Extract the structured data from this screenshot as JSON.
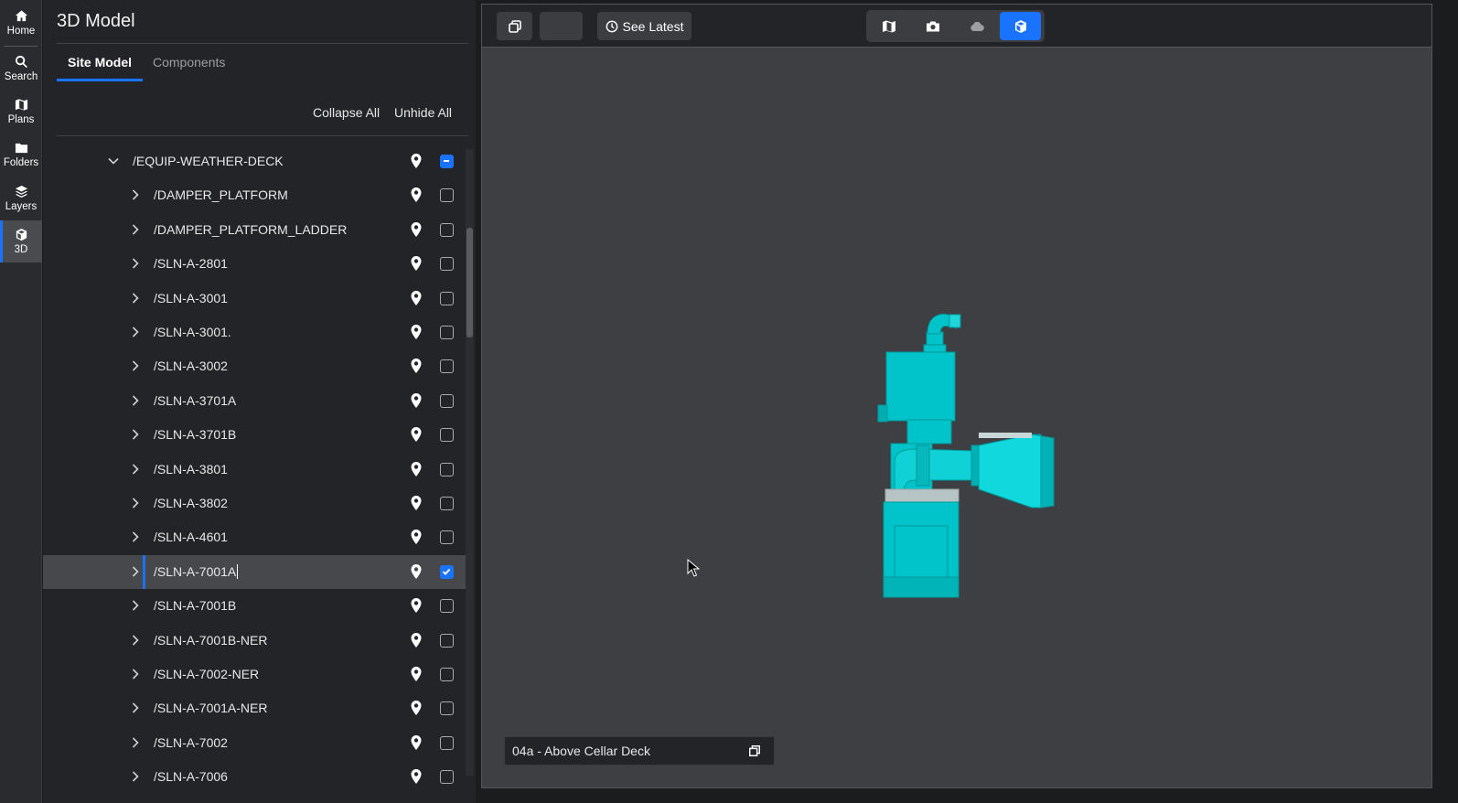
{
  "nav": {
    "items": [
      {
        "label": "Home",
        "icon": "home-icon"
      },
      {
        "label": "Search",
        "icon": "search-icon"
      },
      {
        "label": "Plans",
        "icon": "map-icon"
      },
      {
        "label": "Folders",
        "icon": "folder-icon"
      },
      {
        "label": "Layers",
        "icon": "layers-icon"
      },
      {
        "label": "3D",
        "icon": "cube-icon",
        "active": true
      }
    ]
  },
  "panel": {
    "title": "3D Model",
    "tabs": [
      {
        "label": "Site Model",
        "active": true
      },
      {
        "label": "Components",
        "active": false
      }
    ],
    "collapse_all": "Collapse All",
    "unhide_all": "Unhide All"
  },
  "tree": {
    "parent": {
      "label": "/EQUIP-WEATHER-DECK",
      "state": "partial",
      "expanded": true
    },
    "children": [
      {
        "label": "/DAMPER_PLATFORM",
        "checked": false
      },
      {
        "label": "/DAMPER_PLATFORM_LADDER",
        "checked": false
      },
      {
        "label": "/SLN-A-2801",
        "checked": false
      },
      {
        "label": "/SLN-A-3001",
        "checked": false
      },
      {
        "label": "/SLN-A-3001.",
        "checked": false
      },
      {
        "label": "/SLN-A-3002",
        "checked": false
      },
      {
        "label": "/SLN-A-3701A",
        "checked": false
      },
      {
        "label": "/SLN-A-3701B",
        "checked": false
      },
      {
        "label": "/SLN-A-3801",
        "checked": false
      },
      {
        "label": "/SLN-A-3802",
        "checked": false
      },
      {
        "label": "/SLN-A-4601",
        "checked": false
      },
      {
        "label": "/SLN-A-7001A",
        "checked": true,
        "selected": true
      },
      {
        "label": "/SLN-A-7001B",
        "checked": false
      },
      {
        "label": "/SLN-A-7001B-NER",
        "checked": false
      },
      {
        "label": "/SLN-A-7002-NER",
        "checked": false
      },
      {
        "label": "/SLN-A-7001A-NER",
        "checked": false
      },
      {
        "label": "/SLN-A-7002",
        "checked": false
      },
      {
        "label": "/SLN-A-7006",
        "checked": false
      }
    ]
  },
  "viewer": {
    "see_latest": "See Latest",
    "modes": [
      "map-icon",
      "camera-icon",
      "cloud-icon",
      "cube-icon"
    ],
    "active_mode": 3,
    "floor_label": "04a - Above Cellar Deck",
    "model_color": "#00c8cc"
  },
  "colors": {
    "accent": "#1a73ff",
    "panel_bg": "#232427",
    "viewer_bg": "#3e3f43"
  }
}
